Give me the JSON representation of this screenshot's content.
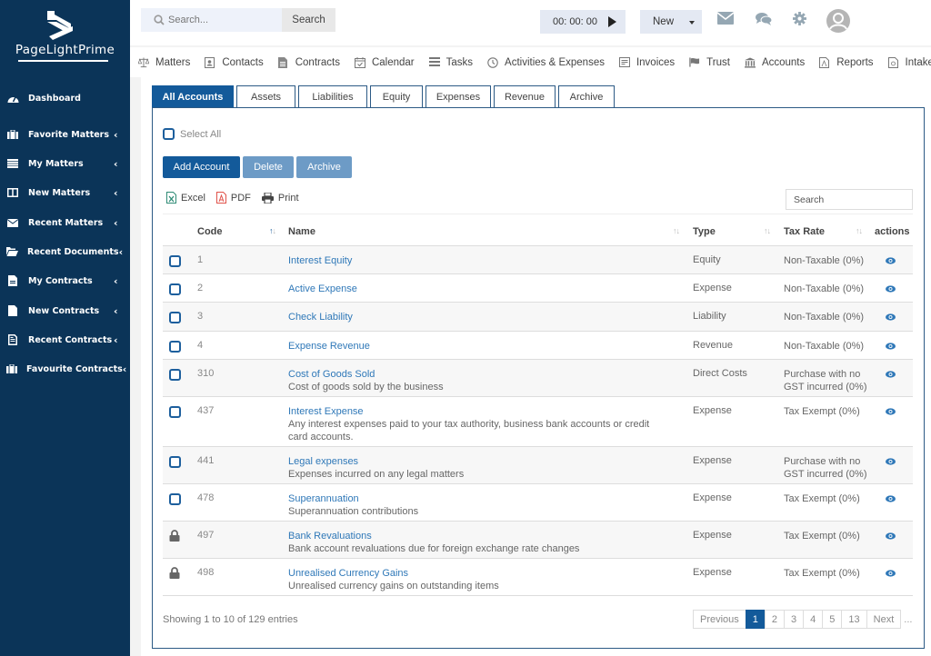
{
  "app": {
    "brand": "PageLightPrime"
  },
  "sidebar": {
    "items": [
      {
        "label": "Dashboard",
        "icon": "dashboard-icon",
        "has_submenu": false
      },
      {
        "label": "Favorite Matters",
        "icon": "briefcase-icon",
        "has_submenu": true
      },
      {
        "label": "My Matters",
        "icon": "list-icon",
        "has_submenu": true
      },
      {
        "label": "New Matters",
        "icon": "columns-icon",
        "has_submenu": true
      },
      {
        "label": "Recent Matters",
        "icon": "envelope-icon",
        "has_submenu": true
      },
      {
        "label": "Recent Documents",
        "icon": "folder-open-icon",
        "has_submenu": true
      },
      {
        "label": "My Contracts",
        "icon": "file-text-icon",
        "has_submenu": true
      },
      {
        "label": "New Contracts",
        "icon": "file-icon",
        "has_submenu": true
      },
      {
        "label": "Recent Contracts",
        "icon": "file-lines-icon",
        "has_submenu": true
      },
      {
        "label": "Favourite Contracts",
        "icon": "briefcase-icon",
        "has_submenu": true
      }
    ],
    "chevron": "‹"
  },
  "topbar": {
    "search_placeholder": "Search...",
    "search_button": "Search",
    "timer": "00: 00: 00",
    "new_button": "New",
    "icons": [
      "envelope-icon",
      "comments-icon",
      "gear-icon",
      "user-avatar-icon"
    ]
  },
  "modules": [
    {
      "label": "Matters",
      "icon": "scale-icon"
    },
    {
      "label": "Contacts",
      "icon": "contact-card-icon"
    },
    {
      "label": "Contracts",
      "icon": "document-icon"
    },
    {
      "label": "Calendar",
      "icon": "calendar-icon"
    },
    {
      "label": "Tasks",
      "icon": "tasks-icon"
    },
    {
      "label": "Activities & Expenses",
      "icon": "clock-icon"
    },
    {
      "label": "Invoices",
      "icon": "invoice-icon"
    },
    {
      "label": "Trust",
      "icon": "flag-icon"
    },
    {
      "label": "Accounts",
      "icon": "bank-icon"
    },
    {
      "label": "Reports",
      "icon": "pdf-report-icon"
    },
    {
      "label": "Intake",
      "icon": "intake-form-icon"
    }
  ],
  "tabs": [
    {
      "label": "All Accounts",
      "active": true
    },
    {
      "label": "Assets",
      "active": false
    },
    {
      "label": "Liabilities",
      "active": false
    },
    {
      "label": "Equity",
      "active": false
    },
    {
      "label": "Expenses",
      "active": false
    },
    {
      "label": "Revenue",
      "active": false
    },
    {
      "label": "Archive",
      "active": false
    }
  ],
  "toolbar": {
    "select_all": "Select All",
    "add_account": "Add Account",
    "delete": "Delete",
    "archive": "Archive",
    "export_excel": "Excel",
    "export_pdf": "PDF",
    "print": "Print",
    "table_search_placeholder": "Search"
  },
  "table": {
    "columns": [
      "Code",
      "Name",
      "Type",
      "Tax Rate",
      "actions"
    ],
    "rows": [
      {
        "locked": false,
        "code": "1",
        "name": "Interest Equity",
        "description": "",
        "type": "Equity",
        "tax_rate": "Non-Taxable (0%)"
      },
      {
        "locked": false,
        "code": "2",
        "name": "Active Expense",
        "description": "",
        "type": "Expense",
        "tax_rate": "Non-Taxable (0%)"
      },
      {
        "locked": false,
        "code": "3",
        "name": "Check Liability",
        "description": "",
        "type": "Liability",
        "tax_rate": "Non-Taxable (0%)"
      },
      {
        "locked": false,
        "code": "4",
        "name": "Expense Revenue",
        "description": "",
        "type": "Revenue",
        "tax_rate": "Non-Taxable (0%)"
      },
      {
        "locked": false,
        "code": "310",
        "name": "Cost of Goods Sold",
        "description": "Cost of goods sold by the business",
        "type": "Direct Costs",
        "tax_rate": "Purchase with no GST incurred (0%)"
      },
      {
        "locked": false,
        "code": "437",
        "name": "Interest Expense",
        "description": "Any interest expenses paid to your tax authority, business bank accounts or credit card accounts.",
        "type": "Expense",
        "tax_rate": "Tax Exempt (0%)"
      },
      {
        "locked": false,
        "code": "441",
        "name": "Legal expenses",
        "description": "Expenses incurred on any legal matters",
        "type": "Expense",
        "tax_rate": "Purchase with no GST incurred (0%)"
      },
      {
        "locked": false,
        "code": "478",
        "name": "Superannuation",
        "description": "Superannuation contributions",
        "type": "Expense",
        "tax_rate": "Tax Exempt (0%)"
      },
      {
        "locked": true,
        "code": "497",
        "name": "Bank Revaluations",
        "description": "Bank account revaluations due for foreign exchange rate changes",
        "type": "Expense",
        "tax_rate": "Tax Exempt (0%)"
      },
      {
        "locked": true,
        "code": "498",
        "name": "Unrealised Currency Gains",
        "description": "Unrealised currency gains on outstanding items",
        "type": "Expense",
        "tax_rate": "Tax Exempt (0%)"
      }
    ]
  },
  "footer": {
    "info": "Showing 1 to 10 of 129 entries",
    "pagination": [
      "Previous",
      "1",
      "2",
      "3",
      "4",
      "5",
      "13",
      "Next"
    ],
    "active_page": "1",
    "ellipsis": "..."
  },
  "colors": {
    "sidebar_bg": "#0b3458",
    "primary": "#135a9a",
    "muted_button": "#6d9bc6",
    "link": "#2f78b8"
  }
}
